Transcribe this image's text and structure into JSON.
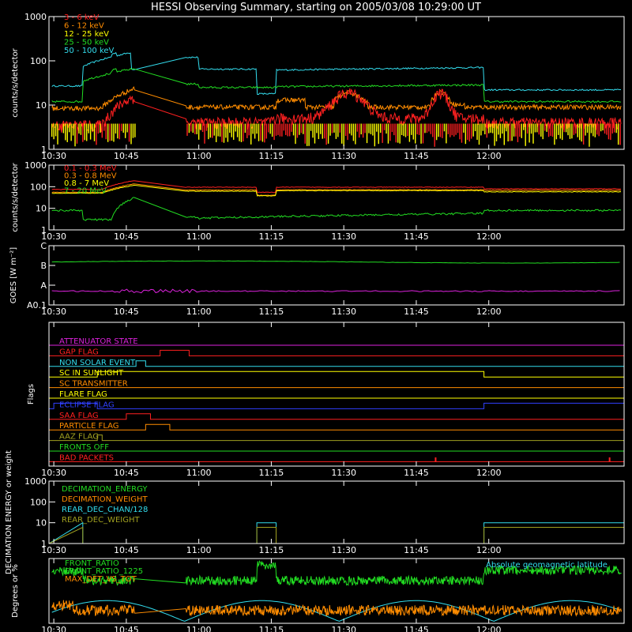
{
  "title": "HESSI Observing Summary, starting on 2005/03/08 10:29:00 UT",
  "time_labels": [
    "10:30",
    "10:45",
    "11:00",
    "11:15",
    "11:30",
    "11:45",
    "12:00"
  ],
  "panel1": {
    "ylabel": "counts/s/detector",
    "yticks": [
      "1",
      "10",
      "100",
      "1000"
    ],
    "legend": [
      {
        "label": "3 - 6 keV",
        "color": "#ff2020"
      },
      {
        "label": "6 - 12 keV",
        "color": "#ff8c00"
      },
      {
        "label": "12 - 25 keV",
        "color": "#ffff00"
      },
      {
        "label": "25 - 50 keV",
        "color": "#22dd22"
      },
      {
        "label": "50 - 100 keV",
        "color": "#33ddee"
      }
    ]
  },
  "panel2": {
    "ylabel": "counts/s/detector",
    "yticks": [
      "1",
      "10",
      "100",
      "1000"
    ],
    "legend": [
      {
        "label": "0.1 - 0.3 MeV",
        "color": "#ff2020"
      },
      {
        "label": "0.3 - 0.8 MeV",
        "color": "#ff8c00"
      },
      {
        "label": "0.8 - 7 MeV",
        "color": "#ffff00"
      },
      {
        "label": "7 - 20 MeV",
        "color": "#22dd22"
      }
    ]
  },
  "panel3": {
    "ylabel": "GOES [W m⁻²]",
    "yticks": [
      "A0.1",
      "A",
      "B",
      "C"
    ]
  },
  "panel4": {
    "ylabel": "Flags",
    "flags": [
      {
        "label": "ATTENUATOR STATE",
        "color": "#dd22dd"
      },
      {
        "label": "GAP FLAG",
        "color": "#ff2020"
      },
      {
        "label": "NON SOLAR EVENT",
        "color": "#33ddee"
      },
      {
        "label": "SC IN SUNLIGHT",
        "color": "#ffff00"
      },
      {
        "label": "SC TRANSMITTER",
        "color": "#ff8c00"
      },
      {
        "label": "FLARE FLAG",
        "color": "#ffff00"
      },
      {
        "label": "ECLIPSE FLAG",
        "color": "#3040ff"
      },
      {
        "label": "SAA FLAG",
        "color": "#ff2020"
      },
      {
        "label": "PARTICLE FLAG",
        "color": "#ff8c00"
      },
      {
        "label": "AAZ FLAG",
        "color": "#a0a020"
      },
      {
        "label": "FRONTS OFF",
        "color": "#22dd22"
      },
      {
        "label": "BAD PACKETS",
        "color": "#ff2020"
      }
    ]
  },
  "panel5": {
    "ylabel": "DECIMATION ENERGY or weight",
    "yticks": [
      "1",
      "10",
      "100",
      "1000"
    ],
    "legend": [
      {
        "label": "DECIMATION_ENERGY",
        "color": "#22dd22"
      },
      {
        "label": "DECIMATION_WEIGHT",
        "color": "#ff8c00"
      },
      {
        "label": "REAR_DEC_CHAN/128",
        "color": "#33ddee"
      },
      {
        "label": "REAR_DEC_WEIGHT",
        "color": "#a0a020"
      }
    ]
  },
  "panel6": {
    "ylabel": "Degrees or %",
    "legend": [
      {
        "label": "FRONT_RATIO",
        "color": "#22dd22"
      },
      {
        "label": "FRONT_RATIO_1225",
        "color": "#22dd22"
      },
      {
        "label": "MAX_DET_VS_TOT",
        "color": "#ff8c00"
      }
    ],
    "note": {
      "label": "Absolute geomagnetic latitude",
      "color": "#33ddee"
    }
  }
}
